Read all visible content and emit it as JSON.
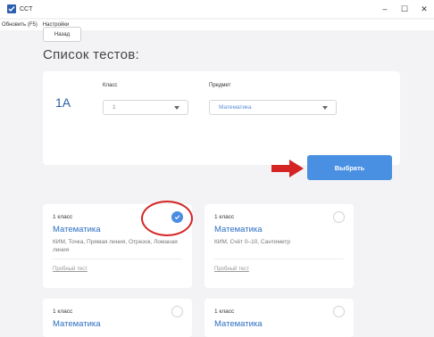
{
  "window": {
    "title": "CCT",
    "minimize": "–",
    "maximize": "☐",
    "close": "✕"
  },
  "menu": {
    "items": [
      "Обновить (F5)",
      "Настройки"
    ]
  },
  "page": {
    "back_label": "Назад",
    "title": "Список тестов:"
  },
  "filter": {
    "class_code": "1А",
    "class_label": "Класс",
    "class_value": "1",
    "subject_label": "Предмет",
    "subject_value": "Математика",
    "choose_label": "Выбрать"
  },
  "colors": {
    "accent": "#4a90e2",
    "annotation_red": "#d42424",
    "link_blue": "#2c6fc2"
  },
  "tests": [
    {
      "class": "1 класс",
      "subject": "Математика",
      "desc": "КИМ, Точка, Прямая линия, Отрезок, Ломаная линия",
      "link": "Пробный тест",
      "selected": true
    },
    {
      "class": "1 класс",
      "subject": "Математика",
      "desc": "КИМ, Счёт 0–10, Сантиметр",
      "link": "Пробный тест",
      "selected": false
    },
    {
      "class": "1 класс",
      "subject": "Математика",
      "desc": "",
      "link": "",
      "selected": false
    },
    {
      "class": "1 класс",
      "subject": "Математика",
      "desc": "",
      "link": "",
      "selected": false
    }
  ]
}
